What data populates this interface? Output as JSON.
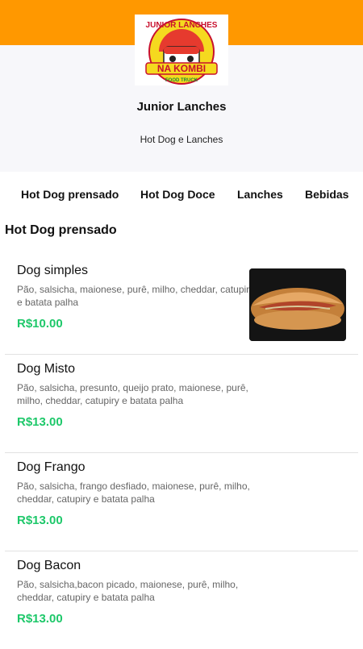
{
  "store": {
    "name": "Junior Lanches",
    "description": "Hot Dog e Lanches",
    "logo": {
      "line1": "JUNIOR LANCHES",
      "line2": "NA KOMBI",
      "line3": "FOOD TRUCK"
    }
  },
  "colors": {
    "header_band": "#ff9800",
    "price": "#1ec86a"
  },
  "categories": [
    "Hot Dog prensado",
    "Hot Dog Doce",
    "Lanches",
    "Bebidas"
  ],
  "section": {
    "title": "Hot Dog prensado",
    "items": [
      {
        "name": "Dog simples",
        "description": "Pão, salsicha, maionese, purê, milho, cheddar, catupiry e batata palha",
        "price": "R$10.00",
        "image": "hot-dog-photo"
      },
      {
        "name": "Dog Misto",
        "description": "Pão, salsicha, presunto, queijo prato, maionese, purê, milho, cheddar, catupiry e batata palha",
        "price": "R$13.00"
      },
      {
        "name": "Dog Frango",
        "description": "Pão, salsicha, frango desfiado, maionese, purê, milho, cheddar, catupiry e batata palha",
        "price": "R$13.00"
      },
      {
        "name": "Dog Bacon",
        "description": "Pão, salsicha,bacon picado, maionese, purê, milho, cheddar, catupiry e batata palha",
        "price": "R$13.00"
      }
    ]
  }
}
